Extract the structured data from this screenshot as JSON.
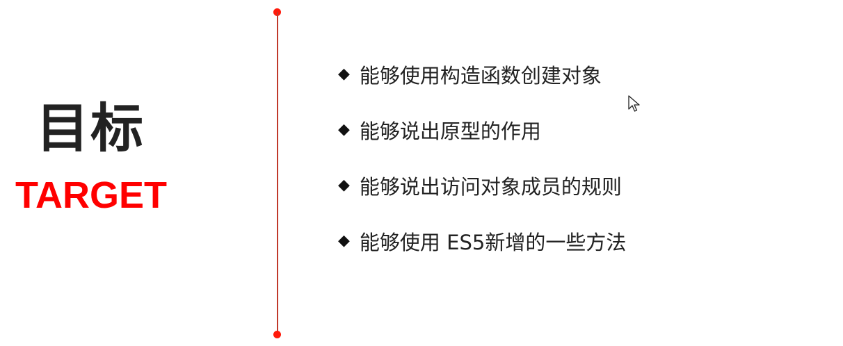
{
  "title": "目标",
  "subtitle": "TARGET",
  "objectives": [
    "能够使用构造函数创建对象",
    "能够说出原型的作用",
    "能够说出访问对象成员的规则",
    "能够使用 ES5新增的一些方法"
  ],
  "bullet_symbol": "◆",
  "colors": {
    "accent": "#ff0000",
    "divider": "#c0392b",
    "text": "#222222"
  }
}
